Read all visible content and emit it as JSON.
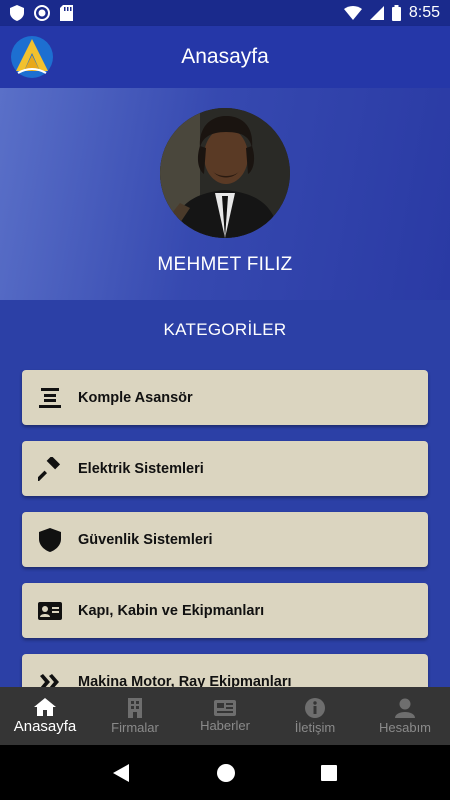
{
  "status_bar": {
    "time": "8:55"
  },
  "app_bar": {
    "title": "Anasayfa"
  },
  "profile": {
    "name": "MEHMET FILIZ"
  },
  "categories": {
    "title": "KATEGORİLER",
    "items": [
      {
        "label": "Komple Asansör",
        "icon": "list-lines-icon"
      },
      {
        "label": "Elektrik Sistemleri",
        "icon": "gavel-icon"
      },
      {
        "label": "Güvenlik Sistemleri",
        "icon": "shield-icon"
      },
      {
        "label": "Kapı, Kabin ve Ekipmanları",
        "icon": "id-card-icon"
      },
      {
        "label": "Makina Motor, Ray Ekipmanları",
        "icon": "double-chevron-icon"
      }
    ]
  },
  "bottom_nav": {
    "items": [
      {
        "label": "Anasayfa",
        "icon": "home-icon",
        "active": true
      },
      {
        "label": "Firmalar",
        "icon": "building-icon",
        "active": false
      },
      {
        "label": "Haberler",
        "icon": "newspaper-icon",
        "active": false
      },
      {
        "label": "İletişim",
        "icon": "info-icon",
        "active": false
      },
      {
        "label": "Hesabım",
        "icon": "person-icon",
        "active": false
      }
    ]
  },
  "colors": {
    "primary": "#2537a8",
    "card": "#dbd5c0",
    "nav": "#353535"
  }
}
